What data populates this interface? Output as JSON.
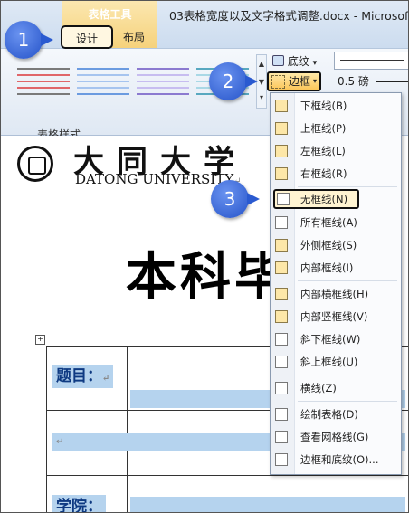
{
  "window": {
    "context_group": "表格工具",
    "doc_title": "03表格宽度以及文字格式调整.docx - Microsoft"
  },
  "tabs": {
    "design": "设计",
    "layout": "布局"
  },
  "ribbon": {
    "group_label": "表格样式",
    "shading_label": "底纹",
    "borders_label": "边框",
    "pen_weight": "0.5 磅",
    "scroll_up": "▲",
    "scroll_down": "▼",
    "scroll_more": "▾",
    "shading_drop": "▾",
    "borders_drop": "▾"
  },
  "document": {
    "university_cn": "大同大学",
    "university_en": "DATONG UNIVERSITY",
    "para_mark": "↵",
    "big_title": "本科毕",
    "anchor": "+",
    "label_topic": "题目：",
    "label_college": "学院："
  },
  "menu": {
    "items": [
      "下框线(B)",
      "上框线(P)",
      "左框线(L)",
      "右框线(R)",
      "无框线(N)",
      "所有框线(A)",
      "外侧框线(S)",
      "内部框线(I)",
      "内部横框线(H)",
      "内部竖框线(V)",
      "斜下框线(W)",
      "斜上框线(U)",
      "横线(Z)",
      "绘制表格(D)",
      "查看网格线(G)",
      "边框和底纹(O)..."
    ]
  },
  "callouts": [
    "1",
    "2",
    "3"
  ],
  "colors": {
    "accent": "#2553c9",
    "highlight": "#fcc65a",
    "cell_fill": "#b5d3ee"
  }
}
